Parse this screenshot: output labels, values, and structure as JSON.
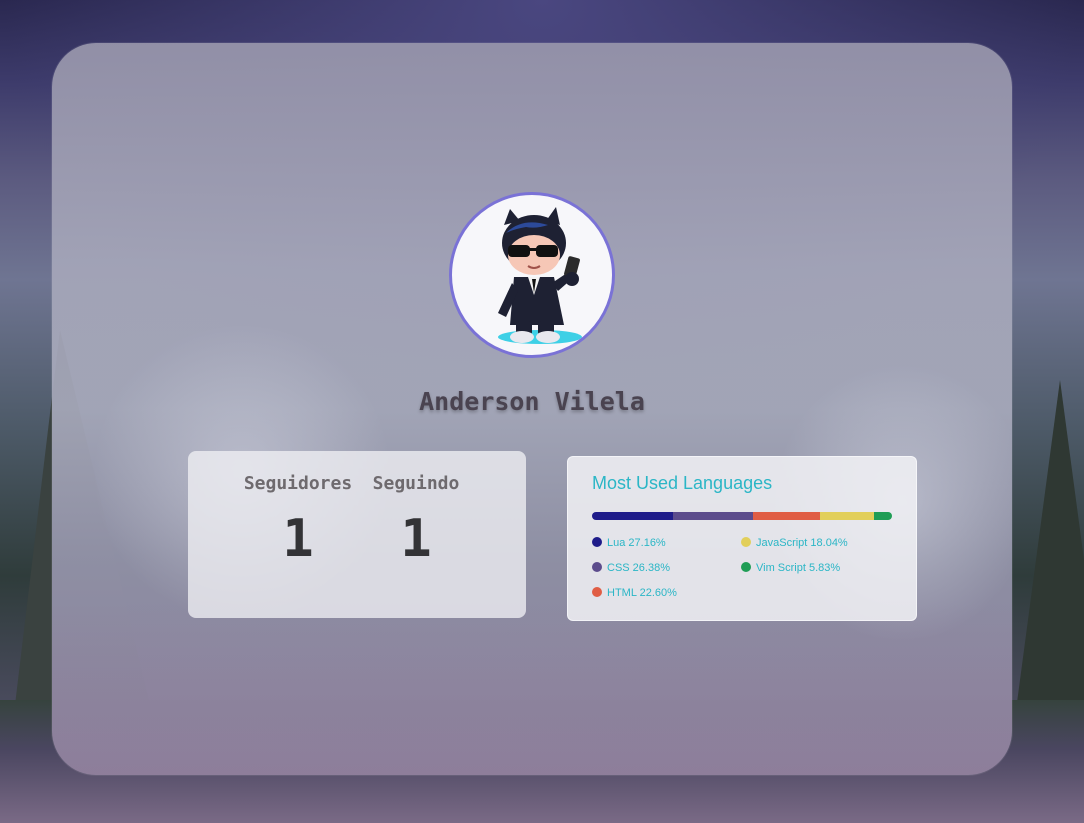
{
  "profile": {
    "name": "Anderson Vilela",
    "avatar_icon": "octocat-sunglasses-avatar",
    "avatar_border_color": "#7a72d6"
  },
  "stats": {
    "followers_label": "Seguidores",
    "followers_value": "1",
    "following_label": "Seguindo",
    "following_value": "1"
  },
  "languages": {
    "title": "Most Used Languages",
    "title_color": "#2bb6c6",
    "items": [
      {
        "label": "Lua 27.16%",
        "name": "Lua",
        "percent": 27.16,
        "color": "#1f1c8a"
      },
      {
        "label": "CSS 26.38%",
        "name": "CSS",
        "percent": 26.38,
        "color": "#5c4c8c"
      },
      {
        "label": "HTML 22.60%",
        "name": "HTML",
        "percent": 22.6,
        "color": "#e05d44"
      },
      {
        "label": "JavaScript 18.04%",
        "name": "JavaScript",
        "percent": 18.04,
        "color": "#e2cf5a"
      },
      {
        "label": "Vim Script 5.83%",
        "name": "Vim Script",
        "percent": 5.83,
        "color": "#1f9d55"
      }
    ]
  }
}
